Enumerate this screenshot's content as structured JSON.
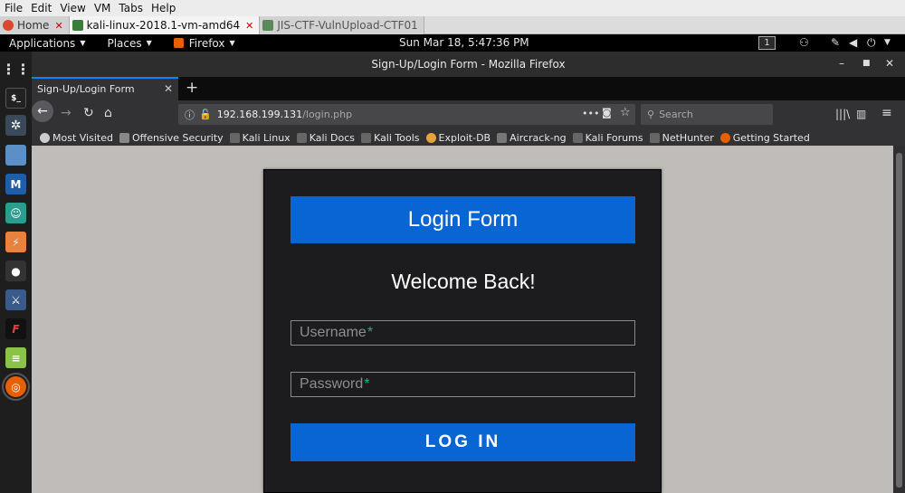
{
  "vm_menu": [
    "File",
    "Edit",
    "View",
    "VM",
    "Tabs",
    "Help"
  ],
  "vm_tabs": [
    {
      "label": "Home",
      "active": false
    },
    {
      "label": "kali-linux-2018.1-vm-amd64",
      "active": true
    },
    {
      "label": "JIS-CTF-VulnUpload-CTF01",
      "active": false
    }
  ],
  "panel": {
    "applications": "Applications",
    "places": "Places",
    "firefox": "Firefox",
    "clock": "Sun Mar 18,  5:47:36 PM",
    "workspace": "1"
  },
  "firefox": {
    "window_title": "Sign-Up/Login Form - Mozilla Firefox",
    "tab_title": "Sign-Up/Login Form",
    "url_host": "192.168.199.131",
    "url_path": "/login.php",
    "search_placeholder": "Search",
    "bookmarks": [
      {
        "label": "Most Visited",
        "icon": "gear-icon",
        "color": "#cccccc"
      },
      {
        "label": "Offensive Security",
        "icon": "offsec-icon",
        "color": "#888888"
      },
      {
        "label": "Kali Linux",
        "icon": "kali-dragon-icon",
        "color": "#aaaaaa"
      },
      {
        "label": "Kali Docs",
        "icon": "kali-dragon-icon",
        "color": "#aaaaaa"
      },
      {
        "label": "Kali Tools",
        "icon": "kali-dragon-icon",
        "color": "#aaaaaa"
      },
      {
        "label": "Exploit-DB",
        "icon": "exploit-db-icon",
        "color": "#e8a33c"
      },
      {
        "label": "Aircrack-ng",
        "icon": "aircrack-icon",
        "color": "#777777"
      },
      {
        "label": "Kali Forums",
        "icon": "kali-dragon-icon",
        "color": "#aaaaaa"
      },
      {
        "label": "NetHunter",
        "icon": "kali-dragon-icon",
        "color": "#aaaaaa"
      },
      {
        "label": "Getting Started",
        "icon": "firefox-icon",
        "color": "#e66000"
      }
    ]
  },
  "login": {
    "header": "Login Form",
    "welcome": "Welcome Back!",
    "username_placeholder": "Username",
    "password_placeholder": "Password",
    "required_mark": "*",
    "submit": "LOG IN"
  },
  "colors": {
    "accent": "#0a65d4",
    "required": "#1ab188",
    "card_bg": "#1c1c1e",
    "page_bg": "#c0bcb9"
  }
}
